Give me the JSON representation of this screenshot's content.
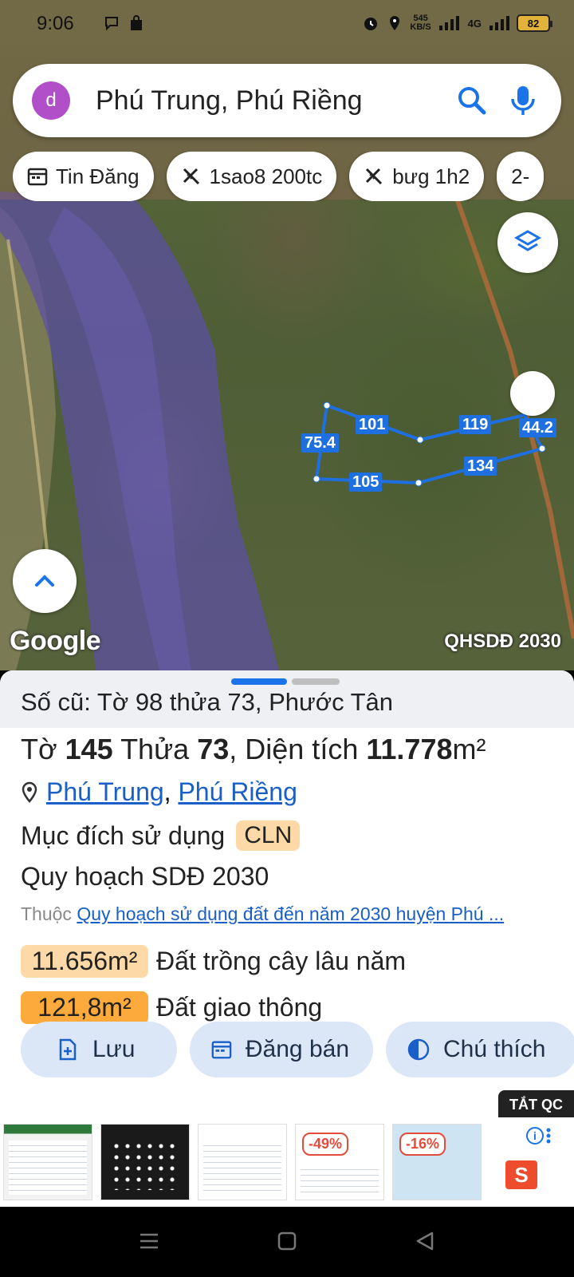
{
  "status": {
    "time": "9:06",
    "net_speed_value": "545",
    "net_speed_unit": "KB/S",
    "net_type": "4G",
    "battery": "82"
  },
  "search": {
    "avatar_letter": "d",
    "query": "Phú Trung, Phú Riềng"
  },
  "chips": [
    {
      "label": "Tin Đăng",
      "icon": "calendar-icon"
    },
    {
      "label": "1sao8 200tc",
      "icon": "ruler-icon"
    },
    {
      "label": "bưg 1h2",
      "icon": "ruler-icon"
    },
    {
      "label": "2-"
    }
  ],
  "map": {
    "logo": "Google",
    "plan_layer": "QHSDĐ 2030",
    "segments": [
      "101",
      "119",
      "75.4",
      "44.2",
      "105",
      "134"
    ],
    "polygon_color": "#1e6fe0"
  },
  "sheet": {
    "old_info": "Số cũ: Tờ 98 thửa 73, Phước Tân",
    "title": {
      "to_label": "Tờ",
      "to_value": "145",
      "thua_label": "Thửa",
      "thua_value": "73",
      "area_label": ", Diện tích",
      "area_value": "11.778",
      "area_unit": "m²"
    },
    "location": {
      "commune": "Phú Trung",
      "separator": ",",
      "district": "Phú Riềng"
    },
    "purpose_label": "Mục đích sử dụng",
    "purpose_code": "CLN",
    "plan_title": "Quy hoạch SDĐ 2030",
    "belong_prefix": "Thuộc",
    "belong_link": "Quy hoạch sử dụng đất đến năm 2030 huyện Phú ...",
    "areas": [
      {
        "value": "11.656m²",
        "label": "Đất trồng cây lâu năm",
        "color": "#fcd9a6"
      },
      {
        "value": "121,8m²",
        "label": "Đất giao thông",
        "color": "#fbaa3b"
      }
    ],
    "actions": {
      "save": "Lưu",
      "post": "Đăng bán",
      "legend": "Chú thích"
    }
  },
  "ads": {
    "tag": "TẮT QC",
    "discount1": "-49%",
    "discount2": "-16%"
  }
}
